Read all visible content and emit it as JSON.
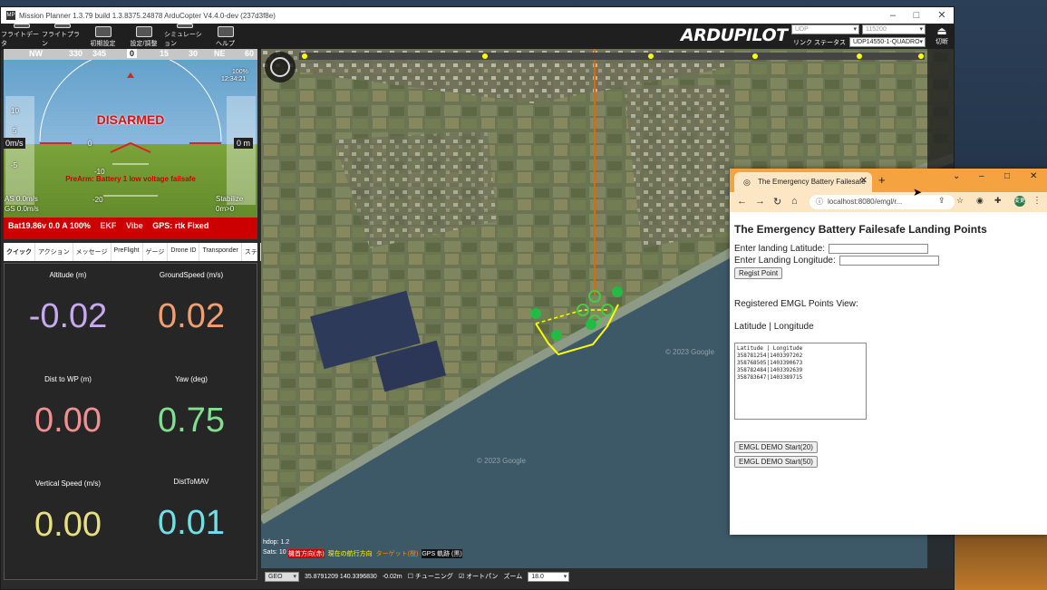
{
  "mp": {
    "title": "Mission Planner 1.3.79 build 1.3.8375.24878 ArduCopter V4.4.0-dev (237d3f8e)",
    "menu": [
      {
        "label": "フライトデータ",
        "icon": "flight-data-icon"
      },
      {
        "label": "フライトプラン",
        "icon": "flight-plan-icon"
      },
      {
        "label": "初期設定",
        "icon": "setup-icon"
      },
      {
        "label": "設定/調整",
        "icon": "config-icon"
      },
      {
        "label": "シミュレーション",
        "icon": "simulation-icon"
      },
      {
        "label": "ヘルプ",
        "icon": "help-icon"
      }
    ],
    "logo": "ARDUPILOT",
    "conn": {
      "protocol": "UDP",
      "baud": "115200",
      "link_stats": "リンク ステータス",
      "target": "UDP14550-1-QUADRO",
      "disconnect": "切断"
    }
  },
  "hud": {
    "compass": [
      "NW",
      "330",
      "345",
      "0",
      "15",
      "30",
      "NE",
      "60"
    ],
    "status": "DISARMED",
    "prearm": "PreArm: Battery 1 low voltage failsafe",
    "airspeed": "AS 0.0m/s",
    "groundspeed": "GS 0.0m/s",
    "mode": "Stabilize",
    "alt_rate": "0m>0",
    "speed_box": "0m/s",
    "alt_box": "0 m",
    "pitch_marks": [
      "10",
      "5",
      "0",
      "-5",
      "-10",
      "-20"
    ],
    "battery_line": "Bat19.86v 0.0 A 100%",
    "ekf": "EKF",
    "vibe": "Vibe",
    "gps": "GPS: rtk Fixed",
    "timer": "12:34:21",
    "battery_pct": "100%"
  },
  "tabs": [
    "クイック",
    "アクション",
    "メッセージ",
    "PreFlight",
    "ゲージ",
    "Drone ID",
    "Transponder",
    "ステ"
  ],
  "quick": [
    {
      "label": "Altitude (m)",
      "value": "-0.02",
      "color": "#c8a8f0"
    },
    {
      "label": "GroundSpeed (m/s)",
      "value": "0.02",
      "color": "#f0a070"
    },
    {
      "label": "Dist to WP (m)",
      "value": "0.00",
      "color": "#f09090"
    },
    {
      "label": "Yaw (deg)",
      "value": "0.75",
      "color": "#80e090"
    },
    {
      "label": "Vertical Speed (m/s)",
      "value": "0.00",
      "color": "#e8e080"
    },
    {
      "label": "DistToMAV",
      "value": "0.01",
      "color": "#70e0e8"
    }
  ],
  "map": {
    "hdop": "hdop: 1.2",
    "sats": "Sats: 10",
    "legend": [
      "機首方向(赤)",
      "現在の航行方向",
      "ターゲット(橙)",
      "GPS 軌跡 (黒)"
    ],
    "copyright1": "© 2023 Google",
    "copyright2": "© 2023 Google",
    "status": {
      "coord_type": "GEO",
      "coords": "35.8791209 140.3396830",
      "alt": "-0.02m",
      "tuning": "チューニング",
      "autopan": "オートパン",
      "zoom_label": "ズーム",
      "zoom": "18.0"
    }
  },
  "browser": {
    "tab_title": "The Emergency Battery Failesafe",
    "url": "localhost:8080/emgl/r...",
    "heading": "The Emergency Battery Failesafe Landing Points",
    "lat_label": "Enter landing Latitude:",
    "lon_label": "Enter Landing Longitude:",
    "regist": "Regist Point",
    "view_label": "Registered EMGL Points View:",
    "cols": "Latitude | Longitude",
    "points": "Latitude | Longitude\n358781254|1403397202\n358768505|1403390673\n358782484|1403392639\n358783647|1403389715",
    "demo20": "EMGL DEMO Start(20)",
    "demo50": "EMGL DEMO Start(50)",
    "profile": "変更"
  }
}
